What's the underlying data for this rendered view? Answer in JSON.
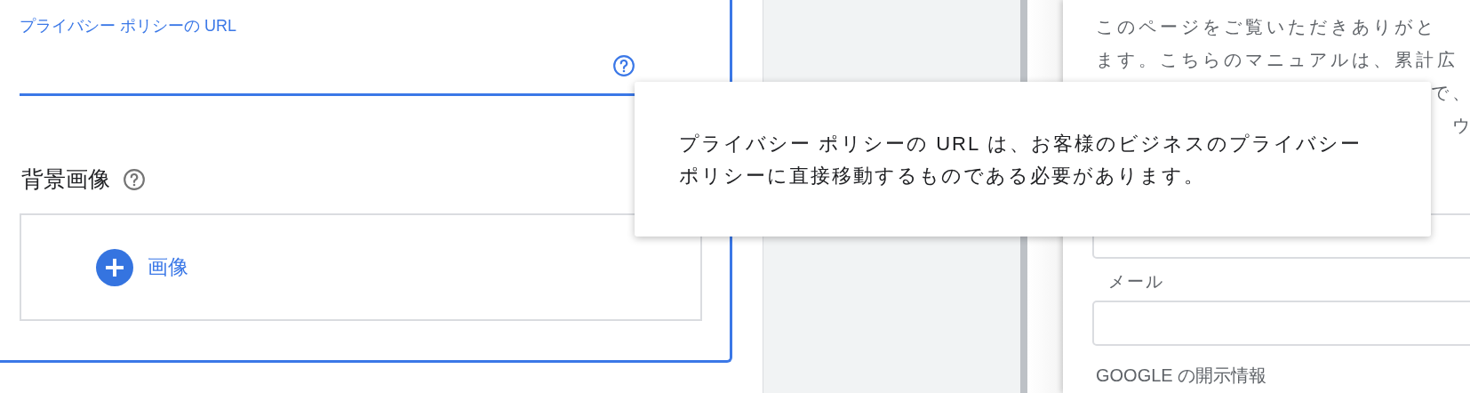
{
  "privacy_url_field": {
    "label": "プライバシー ポリシーの URL",
    "focused": true
  },
  "background_image": {
    "heading": "背景画像",
    "add_button": "画像"
  },
  "tooltip": {
    "text": "プライバシー ポリシーの URL は、お客様のビジネスのプライバシーポリシーに直接移動するものである必要があります。"
  },
  "side_panel": {
    "intro_lines": [
      "このページをご覧いただきありがと",
      "ます。こちらのマニュアルは、累計広"
    ],
    "covered_fragments": [
      "で、",
      "ウ"
    ],
    "fields": [
      {
        "kind": "unlabeled"
      },
      {
        "kind": "labeled",
        "label": "メール"
      }
    ],
    "section_heading": "GOOGLE の開示情報"
  }
}
